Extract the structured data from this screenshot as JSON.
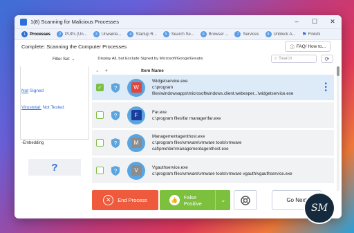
{
  "window": {
    "title": "1(8) Scanning for Malicious Processes",
    "controls": [
      "–",
      "☐",
      "✕"
    ]
  },
  "steps": [
    {
      "num": "1",
      "label": "Processes",
      "active": true
    },
    {
      "num": "2",
      "label": "PUPs (Un..."
    },
    {
      "num": "3",
      "label": "Unwante..."
    },
    {
      "num": "4",
      "label": "Startup R..."
    },
    {
      "num": "5",
      "label": "Search Se..."
    },
    {
      "num": "6",
      "label": "Browser ..."
    },
    {
      "num": "7",
      "label": "Services"
    },
    {
      "num": "8",
      "label": "Unblock A..."
    },
    {
      "num": "",
      "label": "Finishi"
    }
  ],
  "status": {
    "text": "Complete: Scanning the Computer Processes",
    "faq": "FAQ/ How to..."
  },
  "toolbar": {
    "filter_label": "Filter Set:",
    "display_label": "Display All, but Exclude Signed by Microsoft/Googe/Greatis",
    "search_placeholder": "Search"
  },
  "left": {
    "signed_u": "Not",
    "signed_rest": " Signed",
    "virustotal_u": "Virustotal:",
    "virustotal_val": " Not Tested",
    "embedding": "-Embedding",
    "question": "?"
  },
  "table": {
    "header": "Item Name",
    "rows": [
      {
        "name": "Widgetservice.exe",
        "path1": "c:\\program",
        "path2": "files\\windowsapps\\microsoftwindows.client.webexper...\\widgetservice.exe",
        "icon_letter": "W",
        "icon_color": "#e0463c",
        "selected": true
      },
      {
        "name": "Far.exe",
        "path1": "c:\\program files\\far manager\\far.exe",
        "path2": "",
        "icon_letter": "F",
        "icon_color": "#1a3e9a",
        "selected": false
      },
      {
        "name": "Managementagenthost.exe",
        "path1": "c:\\program files\\vmware\\vmware tools\\vmware",
        "path2": "caf\\pme\\bin\\managementagenthost.exe",
        "icon_letter": "M",
        "icon_color": "#8c8c8c",
        "selected": false
      },
      {
        "name": "Vgauthservice.exe",
        "path1": "c:\\program files\\vmware\\vmware tools\\vmware vgauth\\vgauthservice.exe",
        "path2": "",
        "icon_letter": "V",
        "icon_color": "#8c8c8c",
        "selected": false
      }
    ]
  },
  "actions": {
    "end_process": "End Process",
    "false_positive": "False Positive",
    "go_next": "Go Next"
  },
  "logo": {
    "text": "SM"
  }
}
